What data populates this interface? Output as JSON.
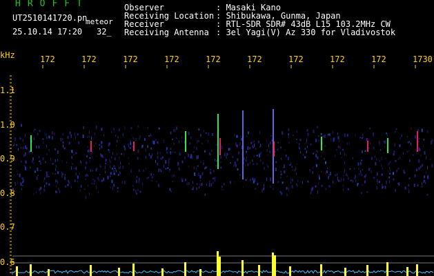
{
  "header": {
    "title": "HROFFT",
    "filename": "UT2510141720.pn",
    "mode": "meteor",
    "datetime": "25.10.14 17:20",
    "seq": "32_",
    "fields": [
      {
        "label": "Observer",
        "value": ": Masaki Kano"
      },
      {
        "label": "Receiving Location",
        "value": ": Shibukawa, Gunma, Japan"
      },
      {
        "label": "Receiver",
        "value": ": RTL-SDR SDR# 43dB L15 103.2MHz CW"
      },
      {
        "label": "Receiving Antenna",
        "value": ": 3el Yagi(V) Az 330 for Vladivostok"
      }
    ]
  },
  "axis": {
    "unit": "kHz",
    "x_ticks": [
      "172",
      "172",
      "172",
      "172",
      "172",
      "172",
      "172",
      "172",
      "172",
      "1730"
    ],
    "y_ticks": [
      "1.1",
      "1.0",
      "0.9",
      "0.8",
      "0.7",
      "0.6"
    ]
  },
  "colors": {
    "background": "#000000",
    "title": "#19c819",
    "text": "#ffffff",
    "axis_labels": "#ffd200",
    "noise_band": "#2030c0",
    "meteor_hot": "#ff2060",
    "meteor_warm": "#30ff60",
    "level_trace": "#ffff30",
    "baseline_trace": "#40c0ff"
  }
}
